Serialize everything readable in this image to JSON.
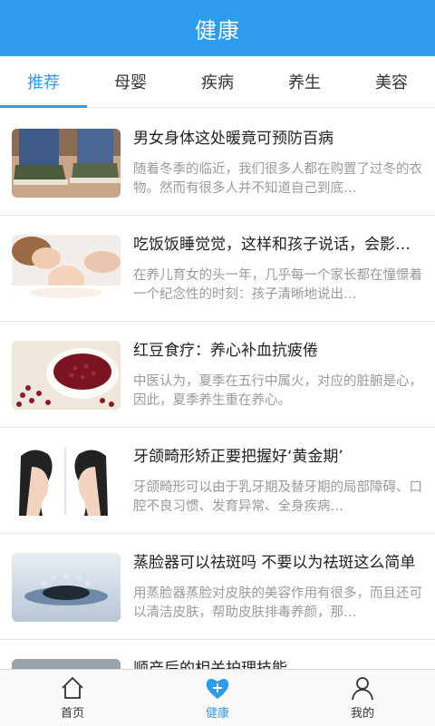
{
  "header": {
    "title": "健康"
  },
  "tabs": [
    {
      "label": "推荐",
      "active": true
    },
    {
      "label": "母婴",
      "active": false
    },
    {
      "label": "疾病",
      "active": false
    },
    {
      "label": "养生",
      "active": false
    },
    {
      "label": "美容",
      "active": false
    }
  ],
  "articles": [
    {
      "title": "男女身体这处暖竟可预防百病",
      "desc": "随着冬季的临近，我们很多人都在购置了过冬的衣物。然而有很多人并不知道自己到底…",
      "thumb": "feet-shoes-image"
    },
    {
      "title": "吃饭饭睡觉觉，这样和孩子说话，会影响…",
      "desc": "在养儿育女的头一年，几乎每一个家长都在憧憬着一个纪念性的时刻：孩子清晰地说出…",
      "thumb": "sleeping-mother-baby-image"
    },
    {
      "title": "红豆食疗：养心补血抗疲倦",
      "desc": "中医认为，夏季在五行中属火，对应的脏腑是心，因此，夏季养生重在养心。",
      "thumb": "red-beans-image"
    },
    {
      "title": "牙颌畸形矫正要把握好‘黄金期’",
      "desc": "牙颌畸形可以由于乳牙期及替牙期的局部障碍、口腔不良习惯、发育异常、全身疾病…",
      "thumb": "face-profile-image"
    },
    {
      "title": "蒸脸器可以祛斑吗 不要以为祛斑这么简单",
      "desc": "用蒸脸器蒸脸对皮肤的美容作用有很多，而且还可以清洁皮肤，帮助皮肤排毒养颜，那…",
      "thumb": "water-splash-image"
    },
    {
      "title": "顺产后的相关护理技能",
      "desc": "",
      "thumb": "partial-image"
    }
  ],
  "tabbar": [
    {
      "label": "首页",
      "icon": "home-icon",
      "active": false
    },
    {
      "label": "健康",
      "icon": "heart-plus-icon",
      "active": true
    },
    {
      "label": "我的",
      "icon": "user-icon",
      "active": false
    }
  ],
  "colors": {
    "accent": "#2f9bec",
    "title": "#222222",
    "desc": "#9a9a9a"
  }
}
